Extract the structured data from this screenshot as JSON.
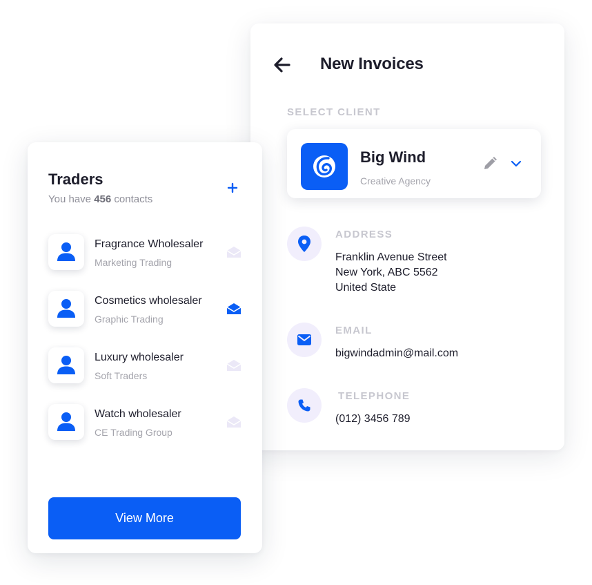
{
  "invoice": {
    "title": "New Invoices",
    "select_client_label": "SELECT CLIENT",
    "client": {
      "name": "Big Wind",
      "subtitle": "Creative Agency"
    },
    "address": {
      "label": "ADDRESS",
      "lines": [
        "Franklin Avenue Street",
        "New York, ABC 5562",
        "United State"
      ]
    },
    "email": {
      "label": "EMAIL",
      "value": "bigwindadmin@mail.com"
    },
    "telephone": {
      "label": "TELEPHONE",
      "value": "(012) 3456 789"
    }
  },
  "traders": {
    "title": "Traders",
    "subtitle_prefix": "You have ",
    "contact_count": "456",
    "subtitle_suffix": " contacts",
    "items": [
      {
        "name": "Fragrance Wholesaler",
        "subtitle": "Marketing Trading",
        "mail_active": false
      },
      {
        "name": "Cosmetics wholesaler",
        "subtitle": "Graphic Trading",
        "mail_active": true
      },
      {
        "name": "Luxury wholesaler",
        "subtitle": "Soft Traders",
        "mail_active": false
      },
      {
        "name": "Watch wholesaler",
        "subtitle": "CE Trading Group",
        "mail_active": false
      }
    ],
    "view_more_label": "View More"
  },
  "colors": {
    "accent": "#0a5ef5",
    "icon_bg": "#f1eefc",
    "muted_label": "#c7c7cf",
    "mail_inactive": "#ebe8f7"
  },
  "icons": {
    "back": "arrow-left-icon",
    "edit": "pencil-icon",
    "dropdown": "chevron-down-icon",
    "address": "location-pin-icon",
    "email": "envelope-icon",
    "telephone": "phone-icon",
    "add": "plus-icon",
    "avatar": "user-icon",
    "mail": "open-envelope-icon"
  }
}
